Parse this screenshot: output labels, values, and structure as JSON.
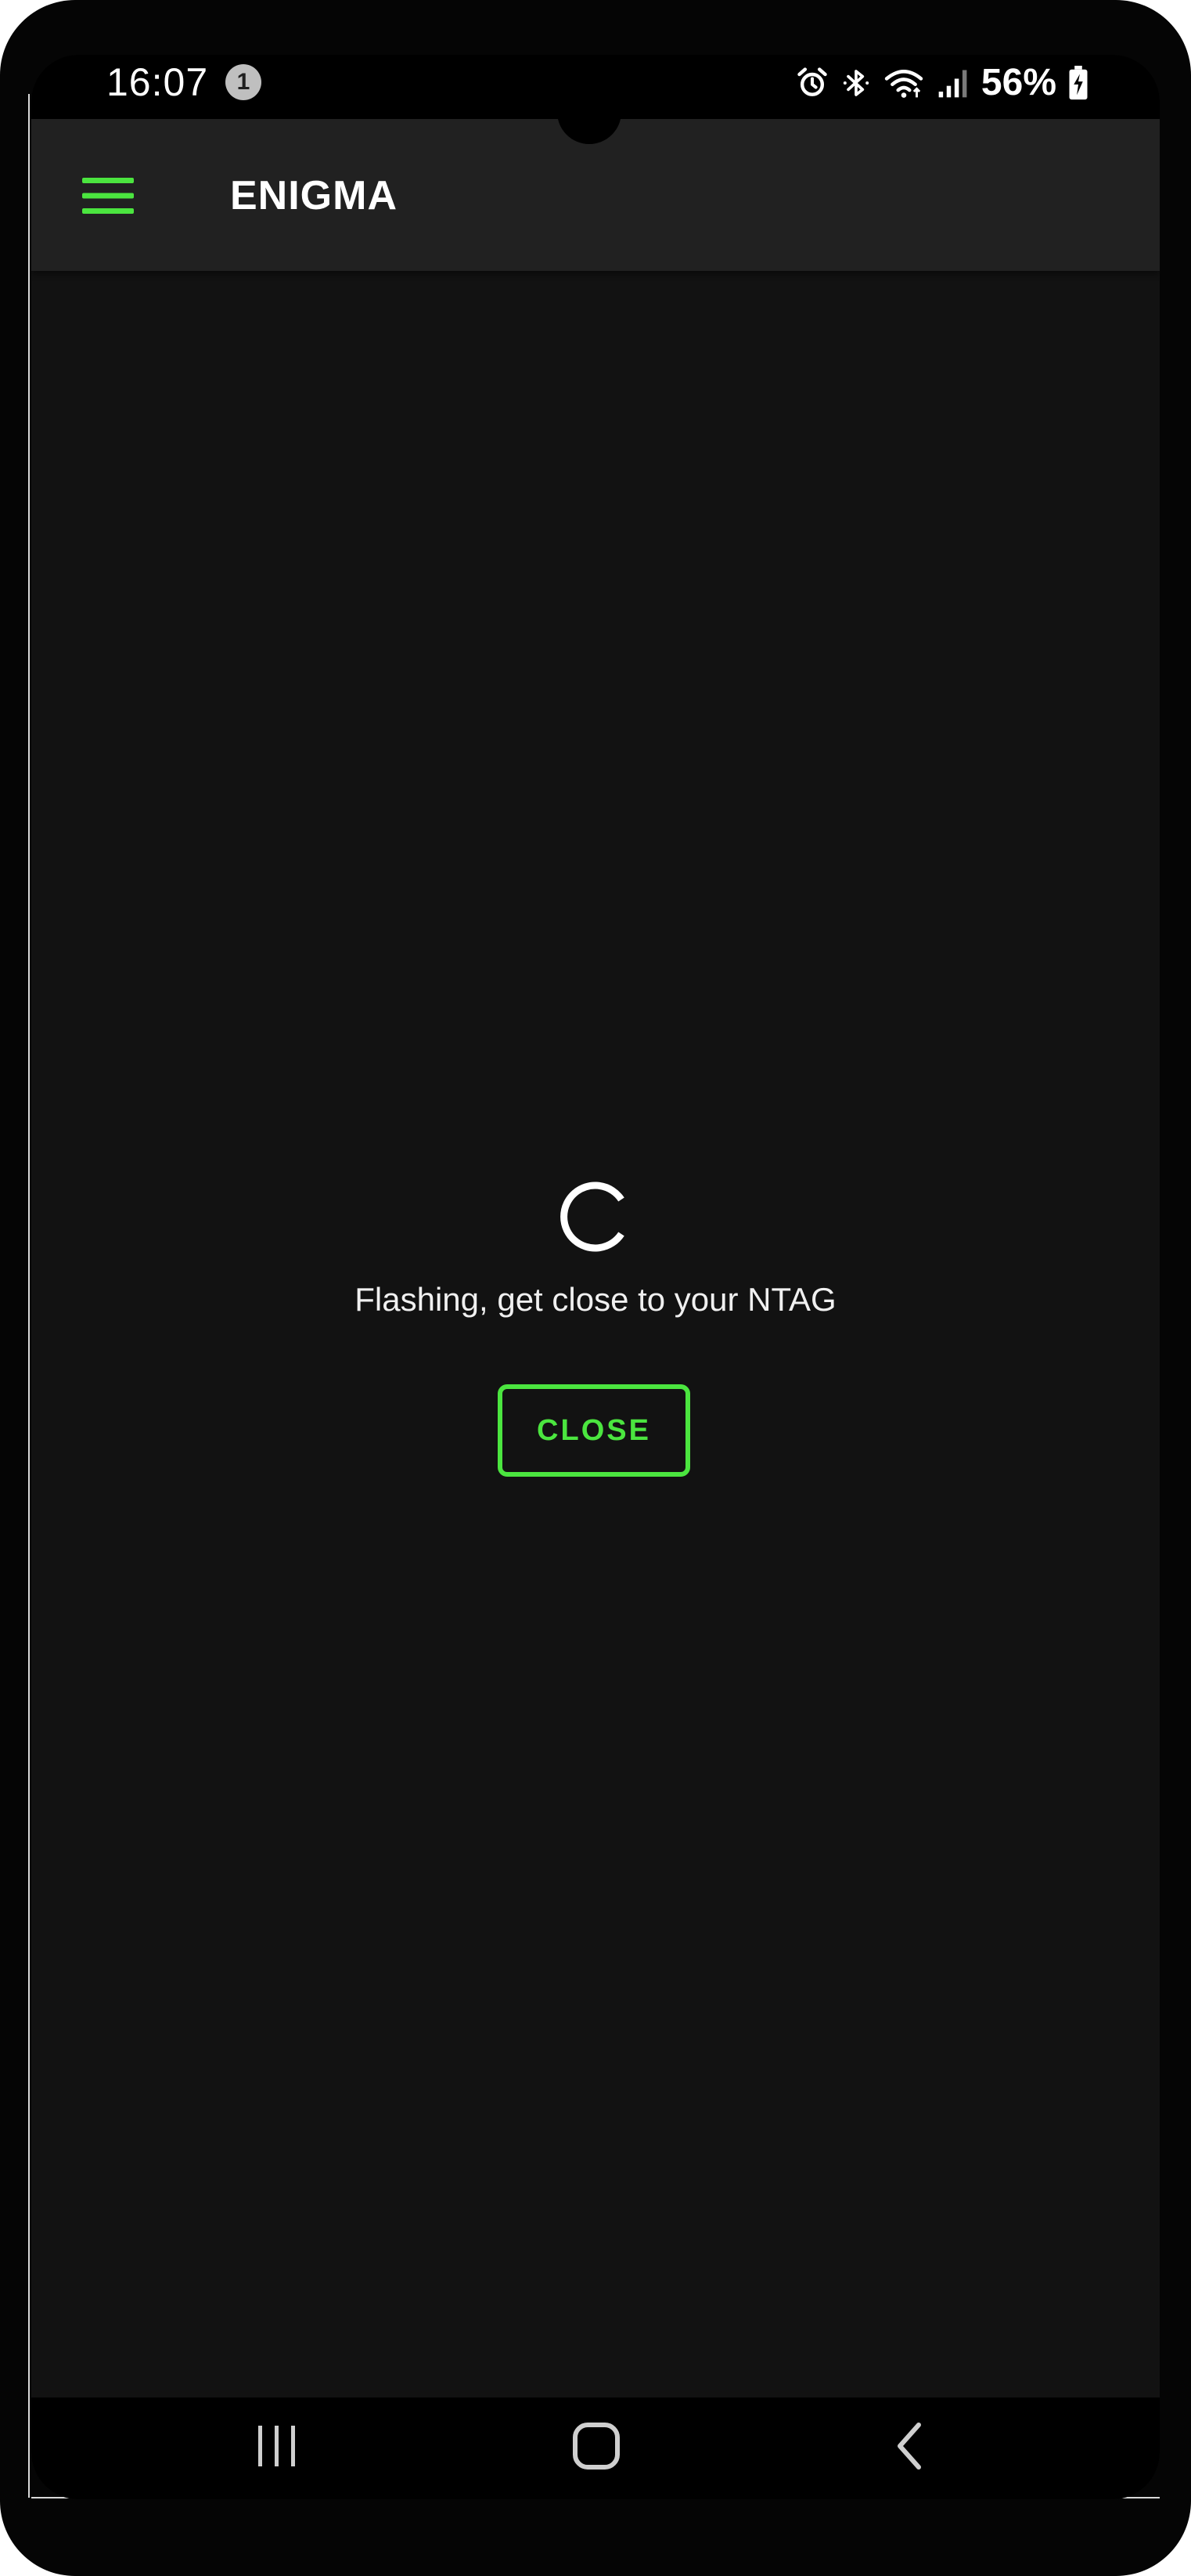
{
  "status_bar": {
    "time": "16:07",
    "notification_count": "1",
    "battery": "56%",
    "icons": [
      "alarm-icon",
      "bluetooth-icon",
      "wifi-icon",
      "signal-icon",
      "battery-charging-icon"
    ]
  },
  "app_bar": {
    "title": "ENIGMA",
    "menu_icon": "hamburger-menu-icon"
  },
  "main": {
    "spinner_icon": "loading-spinner-icon",
    "message": "Flashing, get close to your NTAG",
    "close_label": "CLOSE"
  },
  "nav_bar": {
    "buttons": [
      "recents-icon",
      "home-icon",
      "back-icon"
    ]
  },
  "colors": {
    "accent": "#4be53f",
    "background": "#121212",
    "app_bar": "#212121",
    "text": "#f0f0f0"
  }
}
